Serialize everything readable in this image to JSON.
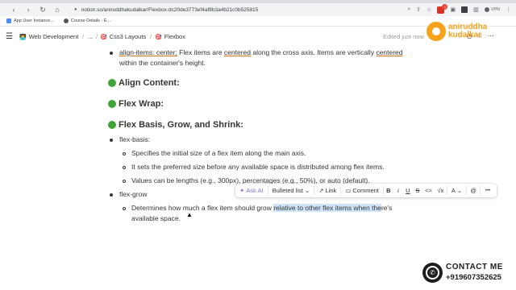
{
  "browser": {
    "url": "notion.so/aniruddhakudalkar/Flexbox-dc20de3773ef4af8b3a4b21c0b525815",
    "bookmarks": [
      "App User Instance...",
      "Course Details - E..."
    ],
    "vpn_label": "VPN",
    "ext_badge": "1"
  },
  "notion": {
    "breadcrumb": {
      "root": "Web Development",
      "ellipsis": "...",
      "parent": "Css3 Layouts",
      "current": "Flexbox",
      "separator": "/"
    },
    "edited_label": "Edited just now"
  },
  "logo": {
    "line1": "aniruddha",
    "line2": "kudalkar"
  },
  "page": {
    "align_items_prop": "align-items: center;",
    "align_items_text_a": " Flex items are ",
    "align_items_word": "centered",
    "align_items_text_b": " along the cross axis. Items are vertically ",
    "align_items_word2": "centered",
    "align_items_line2": "within the container's height.",
    "heading_align_content": "Align Content:",
    "heading_flex_wrap": "Flex Wrap:",
    "heading_basis": "Flex Basis, Grow, and Shrink:",
    "flex_basis_label": "flex-basis:",
    "basis_items": [
      "Specifies the initial size of a flex item along the main axis.",
      "It sets the preferred size before any available space is distributed among flex items.",
      "Values can be lengths (e.g., 300px), percentages (e.g., 50%), or auto (default)."
    ],
    "flex_grow_label": "flex-grow",
    "grow_text_a": "Determines how much a flex item should grow ",
    "grow_text_hl": "relative to other flex items when the",
    "grow_text_b": "re's",
    "grow_line2": "available space."
  },
  "toolbar": {
    "ask_ai": "Ask AI",
    "block_type": "Bulleted list",
    "link": "Link",
    "comment": "Comment",
    "bold": "B",
    "italic": "i",
    "underline": "U",
    "strike": "S",
    "code": "<>",
    "math": "√x",
    "color": "A",
    "mention": "@",
    "more": "•••"
  },
  "contact": {
    "title": "CONTACT ME",
    "phone": "+919607352625"
  }
}
